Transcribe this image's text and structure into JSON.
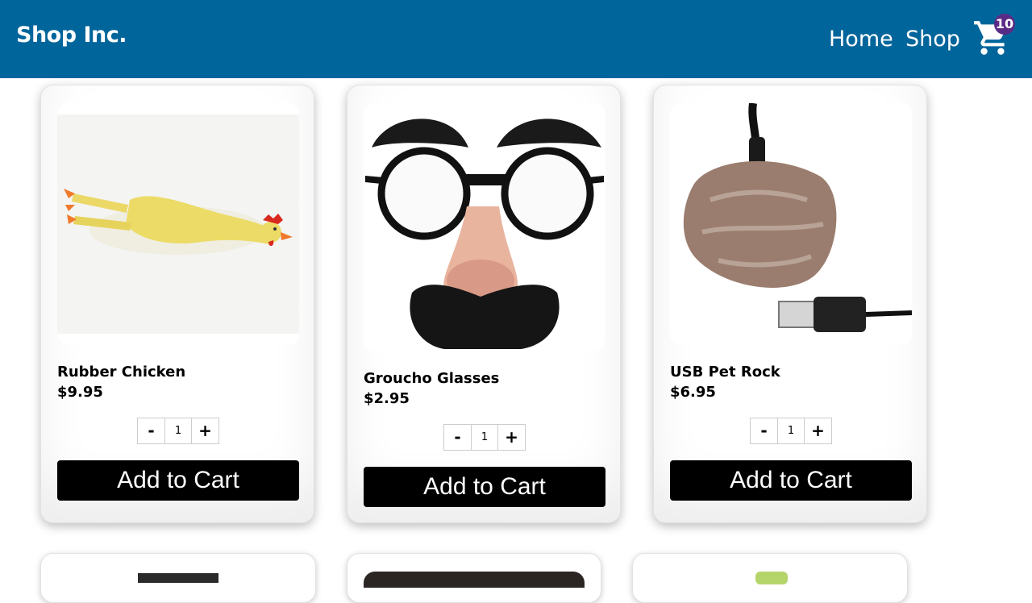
{
  "header": {
    "brand": "Shop Inc.",
    "nav": [
      {
        "label": "Home"
      },
      {
        "label": "Shop"
      }
    ],
    "cart": {
      "icon": "shopping-cart-icon",
      "count": "10"
    }
  },
  "products": [
    {
      "name": "Rubber Chicken",
      "price": "$9.95",
      "qty": "1",
      "minus": "-",
      "plus": "+",
      "add_label": "Add to Cart",
      "image": "rubber-chicken-image"
    },
    {
      "name": "Groucho Glasses",
      "price": "$2.95",
      "qty": "1",
      "minus": "-",
      "plus": "+",
      "add_label": "Add to Cart",
      "image": "groucho-glasses-image"
    },
    {
      "name": "USB Pet Rock",
      "price": "$6.95",
      "qty": "1",
      "minus": "-",
      "plus": "+",
      "add_label": "Add to Cart",
      "image": "usb-pet-rock-image"
    }
  ],
  "colors": {
    "header_bg": "#00659b",
    "badge_bg": "#5a2b86",
    "button_bg": "#000000"
  }
}
